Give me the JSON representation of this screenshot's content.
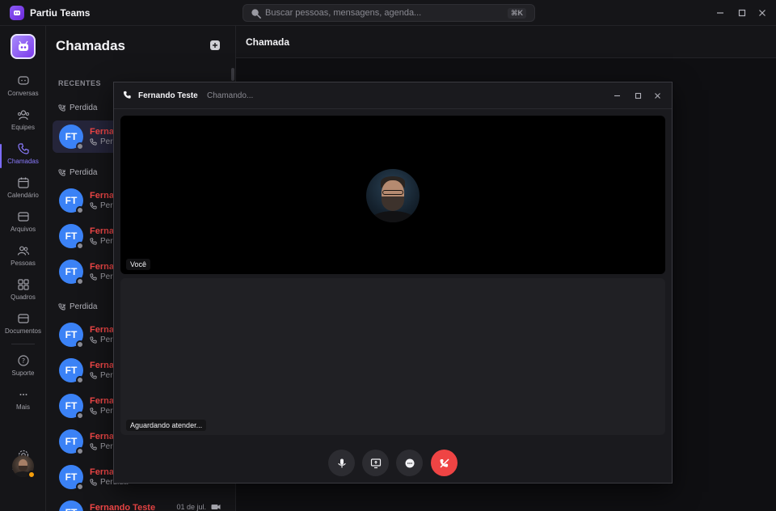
{
  "app": {
    "title": "Partiu Teams",
    "search_placeholder": "Buscar pessoas, mensagens, agenda...",
    "search_shortcut": "⌘K"
  },
  "rail": {
    "items": [
      {
        "label": "Conversas",
        "icon": "chat-icon"
      },
      {
        "label": "Equipes",
        "icon": "team-icon"
      },
      {
        "label": "Chamadas",
        "icon": "phone-icon",
        "active": true
      },
      {
        "label": "Calendário",
        "icon": "calendar-icon"
      },
      {
        "label": "Arquivos",
        "icon": "folder-icon"
      },
      {
        "label": "Pessoas",
        "icon": "people-icon"
      },
      {
        "label": "Quadros",
        "icon": "grid-icon"
      },
      {
        "label": "Documentos",
        "icon": "document-folder-icon"
      },
      {
        "label": "Suporte",
        "icon": "help-icon"
      },
      {
        "label": "Mais",
        "icon": "more-icon"
      },
      {
        "label": "Ajustes",
        "icon": "settings-icon"
      }
    ],
    "user_status_color": "#f59e0b"
  },
  "calls_panel": {
    "title": "Chamadas",
    "section": "RECENTES",
    "groups": [
      {
        "label": "Perdida"
      },
      {
        "label": "Perdida"
      },
      {
        "label": "Perdida"
      }
    ],
    "rows": [
      {
        "initials": "FT",
        "name": "Fernando Teste",
        "sub": "Perdida"
      },
      {
        "initials": "FT",
        "name": "Fernando Teste",
        "sub": "Perdida"
      },
      {
        "initials": "FT",
        "name": "Fernando Teste",
        "sub": "Perdida"
      },
      {
        "initials": "FT",
        "name": "Fernando Teste",
        "sub": "Perdida"
      },
      {
        "initials": "FT",
        "name": "Fernando Teste",
        "sub": "Perdida"
      },
      {
        "initials": "FT",
        "name": "Fernando Teste",
        "sub": "Perdida"
      },
      {
        "initials": "FT",
        "name": "Fernando Teste",
        "sub": "Perdida"
      },
      {
        "initials": "FT",
        "name": "Fernando Teste",
        "sub": "Perdida"
      },
      {
        "initials": "FT",
        "name": "Fernando Teste",
        "sub": "Perdida"
      },
      {
        "initials": "FT",
        "name": "Fernando Teste",
        "sub": "Perdida",
        "date": "01 de jul."
      }
    ],
    "missed_color": "#f04747",
    "avatar_color": "#3b82f6"
  },
  "main": {
    "title": "Chamada"
  },
  "call_window": {
    "contact": "Fernando Teste",
    "status": "Chamando...",
    "self_label": "Você",
    "remote_label": "Aguardando atender...",
    "hangup_color": "#ef4444"
  }
}
